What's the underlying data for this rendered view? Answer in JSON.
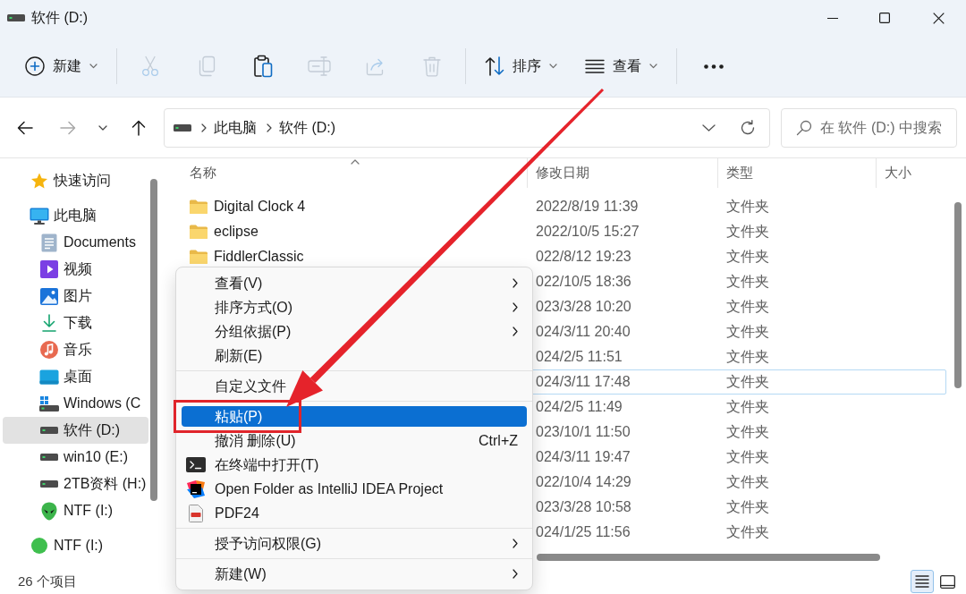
{
  "window": {
    "title": "软件 (D:)"
  },
  "toolbar": {
    "items": [
      {
        "kind": "new",
        "label": "新建",
        "disabled": false
      },
      {
        "kind": "separator"
      },
      {
        "kind": "cut",
        "disabled": true
      },
      {
        "kind": "copy",
        "disabled": true
      },
      {
        "kind": "paste",
        "disabled": false
      },
      {
        "kind": "rename",
        "disabled": true
      },
      {
        "kind": "share",
        "disabled": true
      },
      {
        "kind": "delete",
        "disabled": true
      },
      {
        "kind": "separator"
      },
      {
        "kind": "sort",
        "label": "排序",
        "disabled": false
      },
      {
        "kind": "view",
        "label": "查看",
        "disabled": false
      },
      {
        "kind": "separator"
      },
      {
        "kind": "more",
        "disabled": false
      }
    ]
  },
  "navigation": {
    "back": {
      "disabled": false
    },
    "forward": {
      "disabled": true
    },
    "up": {
      "disabled": false
    }
  },
  "address_bar": {
    "path": [
      "此电脑",
      "软件 (D:)"
    ]
  },
  "search": {
    "placeholder": "在 软件 (D:) 中搜索"
  },
  "sidebar": {
    "items": [
      {
        "kind": "star",
        "label": "快速访问",
        "selected": false
      },
      {
        "kind": "monitor",
        "label": "此电脑",
        "selected": false,
        "children": [
          {
            "kind": "document",
            "label": "Documents",
            "selected": false
          },
          {
            "kind": "video",
            "label": "视频",
            "selected": false
          },
          {
            "kind": "picture",
            "label": "图片",
            "selected": false
          },
          {
            "kind": "download",
            "label": "下载",
            "selected": false
          },
          {
            "kind": "music",
            "label": "音乐",
            "selected": false
          },
          {
            "kind": "desktop",
            "label": "桌面",
            "selected": false
          },
          {
            "kind": "sysdrive",
            "label": "Windows (C",
            "selected": false
          },
          {
            "kind": "drive",
            "label": "软件 (D:)",
            "selected": true
          },
          {
            "kind": "drive",
            "label": "win10 (E:)",
            "selected": false
          },
          {
            "kind": "drive",
            "label": "2TB资料 (H:)",
            "selected": false
          },
          {
            "kind": "alien",
            "label": "NTF (I:)",
            "selected": false
          }
        ]
      },
      {
        "kind": "orb",
        "label": "NTF (I:)",
        "selected": false
      }
    ]
  },
  "file_list": {
    "columns": [
      {
        "label": "名称",
        "sorted": true
      },
      {
        "label": "修改日期",
        "sorted": false
      },
      {
        "label": "类型",
        "sorted": false
      },
      {
        "label": "大小",
        "sorted": false
      }
    ],
    "rows": [
      {
        "name": "Digital Clock 4",
        "modified": "2022/8/19 11:39",
        "type": "文件夹",
        "focused": false
      },
      {
        "name": "eclipse",
        "modified": "2022/10/5 15:27",
        "type": "文件夹",
        "focused": false
      },
      {
        "name": "FiddlerClassic",
        "modified": "022/8/12 19:23",
        "type": "文件夹",
        "focused": false
      },
      {
        "modified": "022/10/5 18:36",
        "type": "文件夹",
        "focused": false
      },
      {
        "modified": "023/3/28 10:20",
        "type": "文件夹",
        "focused": false
      },
      {
        "modified": "024/3/11 20:40",
        "type": "文件夹",
        "focused": false
      },
      {
        "modified": "024/2/5 11:51",
        "type": "文件夹",
        "focused": false
      },
      {
        "modified": "024/3/11 17:48",
        "type": "文件夹",
        "focused": true
      },
      {
        "modified": "024/2/5 11:49",
        "type": "文件夹",
        "focused": false
      },
      {
        "modified": "023/10/1 11:50",
        "type": "文件夹",
        "focused": false
      },
      {
        "modified": "024/3/11 19:47",
        "type": "文件夹",
        "focused": false
      },
      {
        "modified": "022/10/4 14:29",
        "type": "文件夹",
        "focused": false
      },
      {
        "modified": "023/3/28 10:58",
        "type": "文件夹",
        "focused": false
      },
      {
        "modified": "024/1/25 11:56",
        "type": "文件夹",
        "focused": false
      }
    ]
  },
  "context_menu": {
    "items": [
      {
        "kind": "submenu",
        "label": "查看(V)",
        "selected": false
      },
      {
        "kind": "submenu",
        "label": "排序方式(O)",
        "selected": false
      },
      {
        "kind": "submenu",
        "label": "分组依据(P)",
        "selected": false
      },
      {
        "kind": "command",
        "label": "刷新(E)",
        "selected": false
      },
      {
        "kind": "separator"
      },
      {
        "kind": "command",
        "label": "自定义文件",
        "selected": false
      },
      {
        "kind": "separator"
      },
      {
        "kind": "command",
        "label": "粘贴(P)",
        "selected": true
      },
      {
        "kind": "command",
        "label": "撤消 删除(U)",
        "shortcut": "Ctrl+Z",
        "selected": false
      },
      {
        "kind": "terminal",
        "label": "在终端中打开(T)",
        "selected": false
      },
      {
        "kind": "ide",
        "label": "Open Folder as IntelliJ IDEA Project",
        "selected": false
      },
      {
        "kind": "pdf",
        "label": "PDF24",
        "selected": false
      },
      {
        "kind": "separator"
      },
      {
        "kind": "submenu",
        "label": "授予访问权限(G)",
        "selected": false
      },
      {
        "kind": "separator"
      },
      {
        "kind": "submenu",
        "label": "新建(W)",
        "selected": false
      }
    ]
  },
  "status_bar": {
    "item_count": "26 个项目",
    "views": [
      {
        "kind": "details",
        "selected": true
      },
      {
        "kind": "tiles",
        "selected": false
      }
    ]
  }
}
